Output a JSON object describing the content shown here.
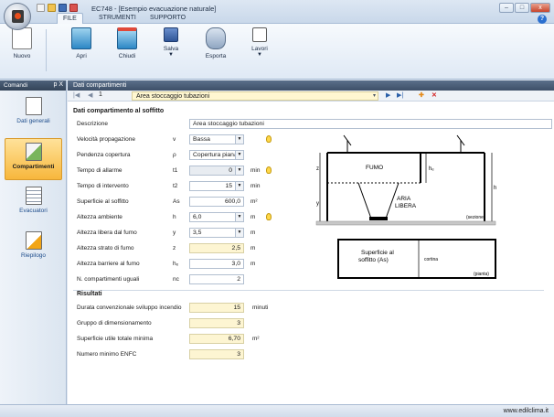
{
  "window": {
    "title": "EC748 - [Esempio evacuazione naturale]",
    "tabs": [
      "FILE",
      "STRUMENTI",
      "SUPPORTO"
    ]
  },
  "ribbon": {
    "buttons": [
      {
        "label": "Nuovo",
        "icon": "new-document-icon"
      },
      {
        "label": "Apri",
        "icon": "open-folder-icon"
      },
      {
        "label": "Chiudi",
        "icon": "close-folder-icon"
      },
      {
        "label": "Salva",
        "icon": "save-icon"
      },
      {
        "label": "Esporta",
        "icon": "export-icon"
      },
      {
        "label": "Lavori",
        "icon": "jobs-icon"
      }
    ]
  },
  "sidebar": {
    "header": "Comandi",
    "header_controls": "p X",
    "items": [
      {
        "label": "Dati generali",
        "active": false
      },
      {
        "label": "Compartimenti",
        "active": true
      },
      {
        "label": "Evacuatori",
        "active": false
      },
      {
        "label": "Riepilogo",
        "active": false
      }
    ]
  },
  "main": {
    "header": "Dati compartimenti",
    "nav": {
      "record_number": "1",
      "compartment_name": "Area stoccaggio tubazioni"
    },
    "section_title": "Dati compartimento al soffitto",
    "description_label": "Descrizione",
    "description_value": "Area stoccaggio tubazioni",
    "fields": [
      {
        "label": "Velocità propagazione",
        "symbol": "v",
        "value": "Bassa",
        "unit": ""
      },
      {
        "label": "Pendenza copertura",
        "symbol": "ρ",
        "value": "Copertura piana",
        "unit": ""
      },
      {
        "label": "Tempo di allarme",
        "symbol": "t1",
        "value": "0",
        "unit": "min"
      },
      {
        "label": "Tempo di intervento",
        "symbol": "t2",
        "value": "15",
        "unit": "min"
      },
      {
        "label": "Superficie al soffitto",
        "symbol": "As",
        "value": "600,0",
        "unit": "m²"
      },
      {
        "label": "Altezza ambiente",
        "symbol": "h",
        "value": "6,0",
        "unit": "m"
      },
      {
        "label": "Altezza libera dal fumo",
        "symbol": "y",
        "value": "3,5",
        "unit": "m"
      },
      {
        "label": "Altezza strato di fumo",
        "symbol": "z",
        "value": "2,5",
        "unit": "m"
      },
      {
        "label": "Altezza barriere al fumo",
        "symbol": "hₑ",
        "value": "3,0",
        "unit": "m"
      },
      {
        "label": "N. compartimenti uguali",
        "symbol": "nc",
        "value": "2",
        "unit": ""
      }
    ],
    "results": {
      "title": "Risultati",
      "rows": [
        {
          "label": "Durata convenzionale sviluppo incendio",
          "value": "15",
          "unit": "minuti"
        },
        {
          "label": "Gruppo di dimensionamento",
          "value": "3",
          "unit": ""
        },
        {
          "label": "Superficie utile totale minima",
          "value": "6,70",
          "unit": "m²"
        },
        {
          "label": "Numero minimo ENFC",
          "value": "3",
          "unit": ""
        }
      ]
    },
    "diagram": {
      "fumo": "FUMO",
      "aria_libera": "ARIA\nLIBERA",
      "sezione": "(sezione)",
      "superficie": "Superficie al\nsoffitto (As)",
      "cortina": "cortina",
      "pianta": "(pianta)",
      "z": "z",
      "y": "y",
      "h": "h",
      "hb": "hₑ"
    }
  },
  "status": {
    "site": "www.edilclima.it"
  },
  "colors": {
    "accent": "#f7b73c",
    "readonly": "#fdf5d2",
    "header": "#3e5068"
  }
}
